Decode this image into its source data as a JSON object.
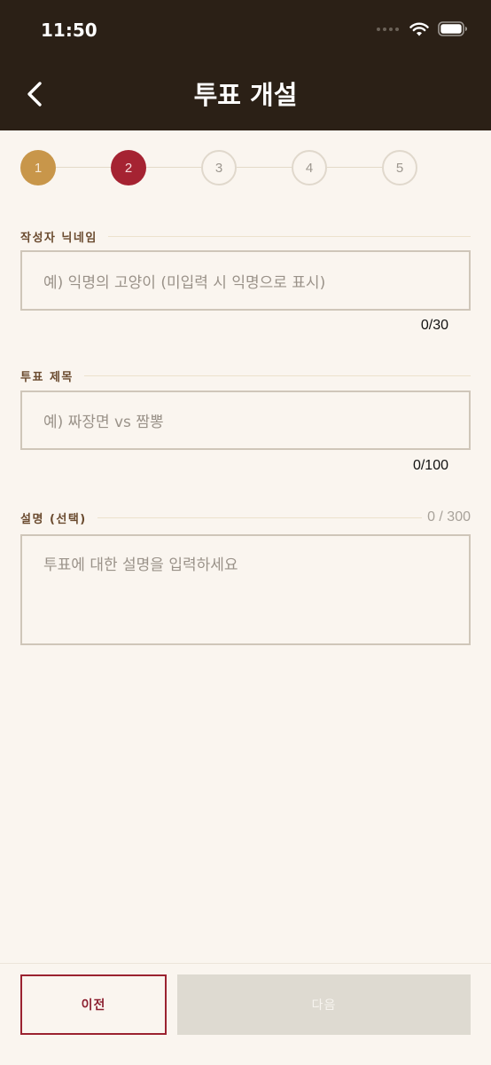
{
  "status_bar": {
    "time": "11:50"
  },
  "header": {
    "title": "투표 개설"
  },
  "stepper": {
    "steps": [
      "1",
      "2",
      "3",
      "4",
      "5"
    ],
    "current": 2
  },
  "nickname": {
    "label": "작성자 닉네임",
    "placeholder": "예) 익명의 고양이 (미입력 시 익명으로 표시)",
    "counter": "0/30"
  },
  "title_field": {
    "label": "투표 제목",
    "placeholder": "예) 짜장면 vs 짬뽕",
    "counter": "0/100"
  },
  "description": {
    "label": "설명 (선택)",
    "counter": "0 / 300",
    "placeholder": "투표에 대한 설명을 입력하세요"
  },
  "buttons": {
    "prev": "이전",
    "next": "다음"
  },
  "colors": {
    "header_bg": "#2b2016",
    "step_done": "#c8964a",
    "step_active": "#a52332",
    "accent": "#9b2230",
    "page_bg": "#faf5ef"
  }
}
